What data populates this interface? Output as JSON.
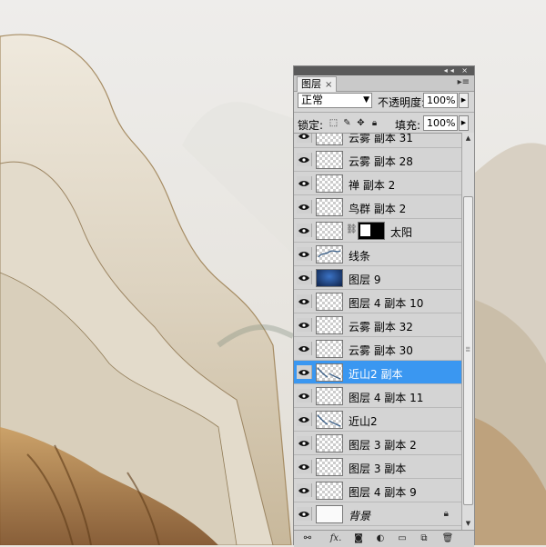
{
  "panel": {
    "tab_label": "图层",
    "tab_close": "×",
    "menu_glyph": "▸≡",
    "titlebar_buttons": "◂◂ ×",
    "blend_mode": "正常",
    "opacity_label": "不透明度:",
    "opacity_value": "100%",
    "lock_label": "锁定:",
    "fill_label": "填充:",
    "fill_value": "100%"
  },
  "layers": [
    {
      "name": "云雾 副本 31",
      "thumb": "transparent",
      "selected": false
    },
    {
      "name": "云雾 副本 28",
      "thumb": "transparent",
      "selected": false
    },
    {
      "name": "禅 副本 2",
      "thumb": "transparent",
      "selected": false
    },
    {
      "name": "鸟群 副本 2",
      "thumb": "transparent",
      "selected": false
    },
    {
      "name": "太阳",
      "thumb": "transparent",
      "mask": true,
      "selected": false
    },
    {
      "name": "线条",
      "thumb": "lines",
      "selected": false
    },
    {
      "name": "图层 9",
      "thumb": "blue",
      "selected": false
    },
    {
      "name": "图层 4 副本 10",
      "thumb": "transparent",
      "selected": false
    },
    {
      "name": "云雾 副本 32",
      "thumb": "transparent",
      "selected": false
    },
    {
      "name": "云雾 副本 30",
      "thumb": "transparent",
      "selected": false
    },
    {
      "name": "近山2 副本",
      "thumb": "mountain",
      "selected": true
    },
    {
      "name": "图层 4 副本 11",
      "thumb": "transparent",
      "selected": false
    },
    {
      "name": "近山2",
      "thumb": "mountain",
      "selected": false
    },
    {
      "name": "图层 3 副本 2",
      "thumb": "transparent",
      "selected": false
    },
    {
      "name": "图层 3 副本",
      "thumb": "transparent",
      "selected": false
    },
    {
      "name": "图层 4 副本 9",
      "thumb": "transparent",
      "selected": false
    },
    {
      "name": "背景",
      "thumb": "plain",
      "selected": false,
      "locked": true
    }
  ],
  "toolbar": {
    "link_icon": "link-layers-icon",
    "fx_label": "fx.",
    "mask_icon": "add-mask-icon",
    "adjust_icon": "adjustment-layer-icon",
    "group_icon": "new-group-icon",
    "new_icon": "new-layer-icon",
    "trash_icon": "delete-layer-icon"
  },
  "colors": {
    "selection": "#3a97f1",
    "panel_bg": "#d6d6d6"
  }
}
